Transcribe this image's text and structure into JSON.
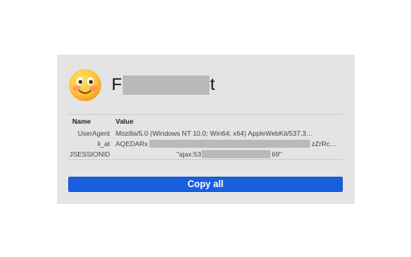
{
  "profile": {
    "avatar_icon": "smiling-face-emoji-icon",
    "name_prefix": "F",
    "name_suffix": "t"
  },
  "cookies": {
    "headers": [
      "Name",
      "Value"
    ],
    "rows": [
      {
        "name": "UserAgent",
        "value": "Mozilla/5.0 (Windows NT 10.0; Win64; x64) AppleWebKit/537.3…"
      },
      {
        "name": "li_at",
        "value_prefix": "AQEDARx",
        "value_suffix": "zZrRc…"
      },
      {
        "name": "JSESSIONID",
        "value_prefix": "\"ajax:53",
        "value_suffix": "69\""
      }
    ]
  },
  "actions": {
    "copy_all_label": "Copy all",
    "accent_color": "#1a5fe0"
  }
}
